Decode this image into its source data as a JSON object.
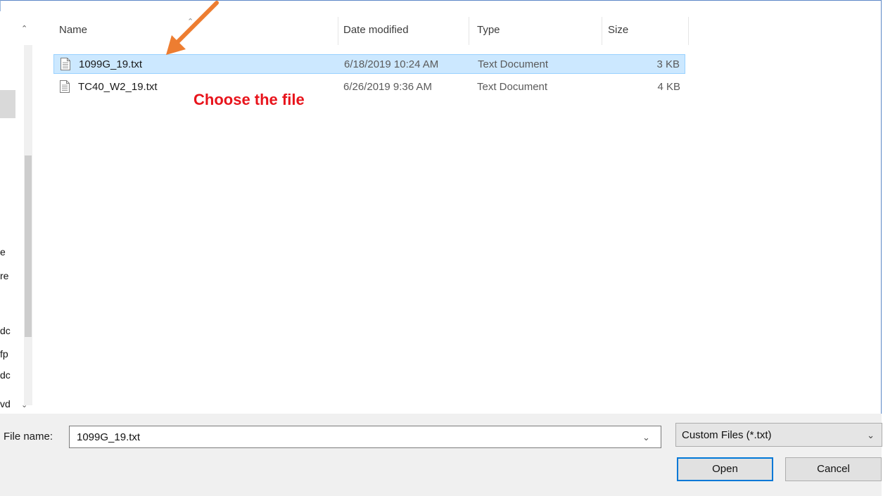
{
  "columns": {
    "name": "Name",
    "date_modified": "Date modified",
    "type": "Type",
    "size": "Size"
  },
  "files": [
    {
      "name": "1099G_19.txt",
      "date": "6/18/2019 10:24 AM",
      "type": "Text Document",
      "size": "3 KB",
      "selected": true
    },
    {
      "name": "TC40_W2_19.txt",
      "date": "6/26/2019 9:36 AM",
      "type": "Text Document",
      "size": "4 KB",
      "selected": false
    }
  ],
  "annotation": {
    "text": "Choose the file",
    "color": "#e8141c",
    "arrow_color": "#ed7d31"
  },
  "nav_pane_fragments": [
    "e",
    "re",
    "dc",
    "fp",
    "dc",
    "vd"
  ],
  "filename": {
    "label": "File name:",
    "value": "1099G_19.txt"
  },
  "filetype": {
    "selected": "Custom Files (*.txt)"
  },
  "buttons": {
    "open": "Open",
    "cancel": "Cancel"
  },
  "colors": {
    "selection_bg": "#cce8ff",
    "selection_border": "#99d1ff",
    "accent": "#0078d7"
  },
  "icons": {
    "sort": "chevron-up-icon",
    "file": "text-file-icon",
    "dropdown": "chevron-down-icon"
  }
}
